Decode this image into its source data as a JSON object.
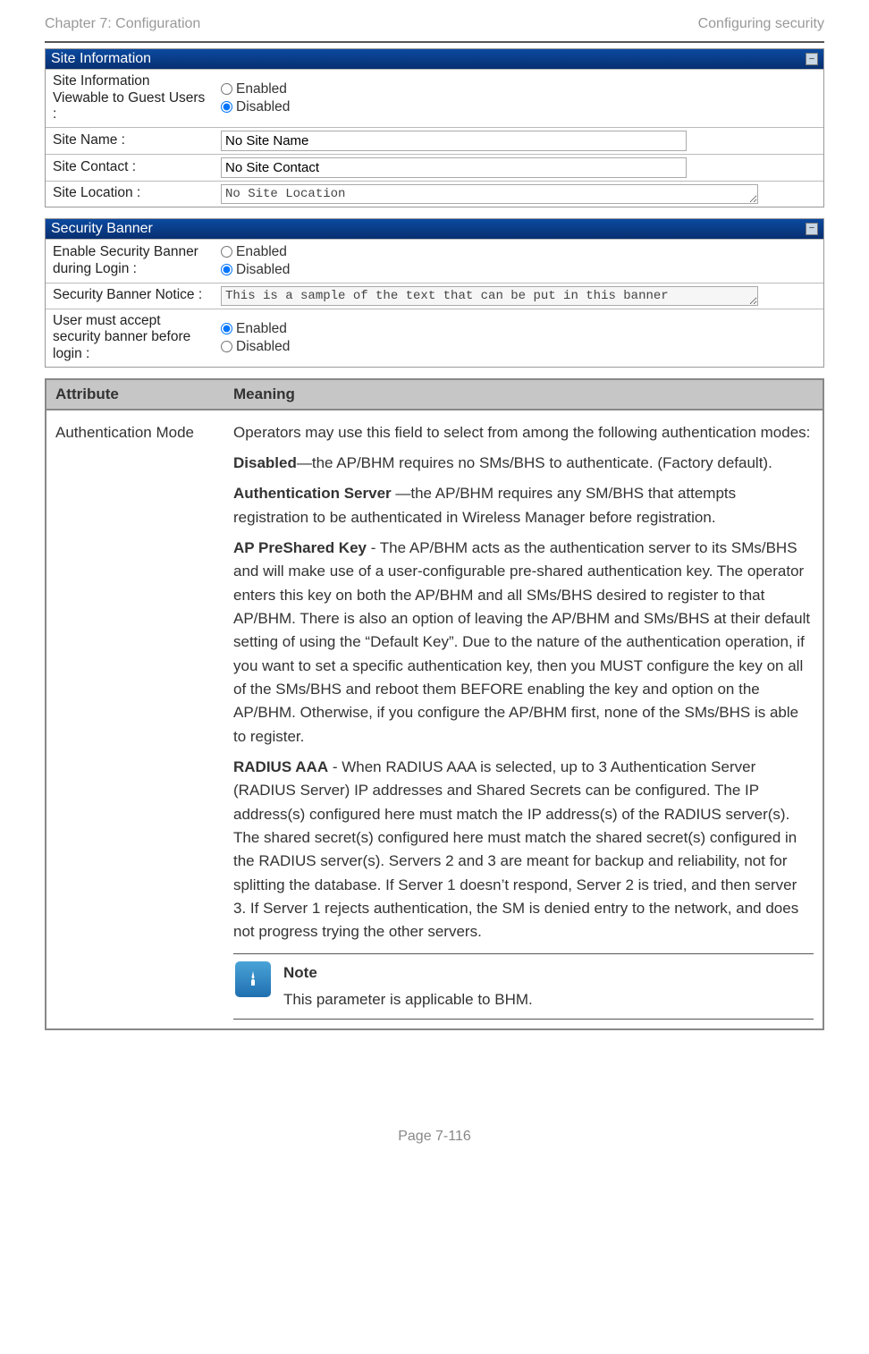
{
  "header": {
    "left": "Chapter 7:  Configuration",
    "right": "Configuring security"
  },
  "radio_options": {
    "enabled": "Enabled",
    "disabled": "Disabled"
  },
  "panels": {
    "site": {
      "title": "Site Information",
      "rows": {
        "viewable": "Site Information Viewable to Guest Users :",
        "name_label": "Site Name :",
        "name_value": "No Site Name",
        "contact_label": "Site Contact :",
        "contact_value": "No Site Contact",
        "location_label": "Site Location :",
        "location_value": "No Site Location"
      }
    },
    "banner": {
      "title": "Security Banner",
      "rows": {
        "enable_label": "Enable Security Banner during Login :",
        "notice_label": "Security Banner Notice :",
        "notice_value": "This is a sample of the text that can be put in this banner",
        "accept_label": "User must accept security banner before login :"
      }
    }
  },
  "table": {
    "col_attr": "Attribute",
    "col_meaning": "Meaning",
    "row1_attr": "Authentication Mode",
    "row1_intro": "Operators may use this field to select from among the following authentication modes:",
    "row1_disabled_b": "Disabled",
    "row1_disabled_t": "—the AP/BHM requires no SMs/BHS to authenticate. (Factory default).",
    "row1_authsrv_b": "Authentication Server",
    "row1_authsrv_t": " —the AP/BHM requires any SM/BHS that attempts registration to be authenticated in Wireless Manager before registration.",
    "row1_psk_b": "AP PreShared Key",
    "row1_psk_t": " - The AP/BHM acts as the authentication server to its SMs/BHS and will make use of a user-configurable pre-shared authentication key. The operator enters this key on both the AP/BHM and all SMs/BHS desired to register to that AP/BHM. There is also an option of leaving the AP/BHM and SMs/BHS at their default setting of using the “Default Key”. Due to the nature of the authentication operation, if you want to set a specific authentication key, then you MUST configure the key on all of the SMs/BHS and reboot them BEFORE enabling the key and option on the AP/BHM. Otherwise, if you configure the AP/BHM first, none of the SMs/BHS is able to register.",
    "row1_radius_b": "RADIUS AAA",
    "row1_radius_t": " - When RADIUS AAA is selected, up to 3 Authentication Server (RADIUS Server) IP addresses and Shared Secrets can be configured. The IP address(s) configured here must match the IP address(s) of the RADIUS server(s). The shared secret(s) configured here must match the shared secret(s) configured in the RADIUS server(s). Servers 2 and 3 are meant for backup and reliability, not for splitting the database. If Server 1 doesn’t respond, Server 2 is tried, and then server 3. If Server 1 rejects authentication, the SM is denied entry to the network, and does not progress trying the other servers."
  },
  "note": {
    "title": "Note",
    "body": "This parameter is applicable to BHM."
  },
  "footer": "Page 7-116"
}
